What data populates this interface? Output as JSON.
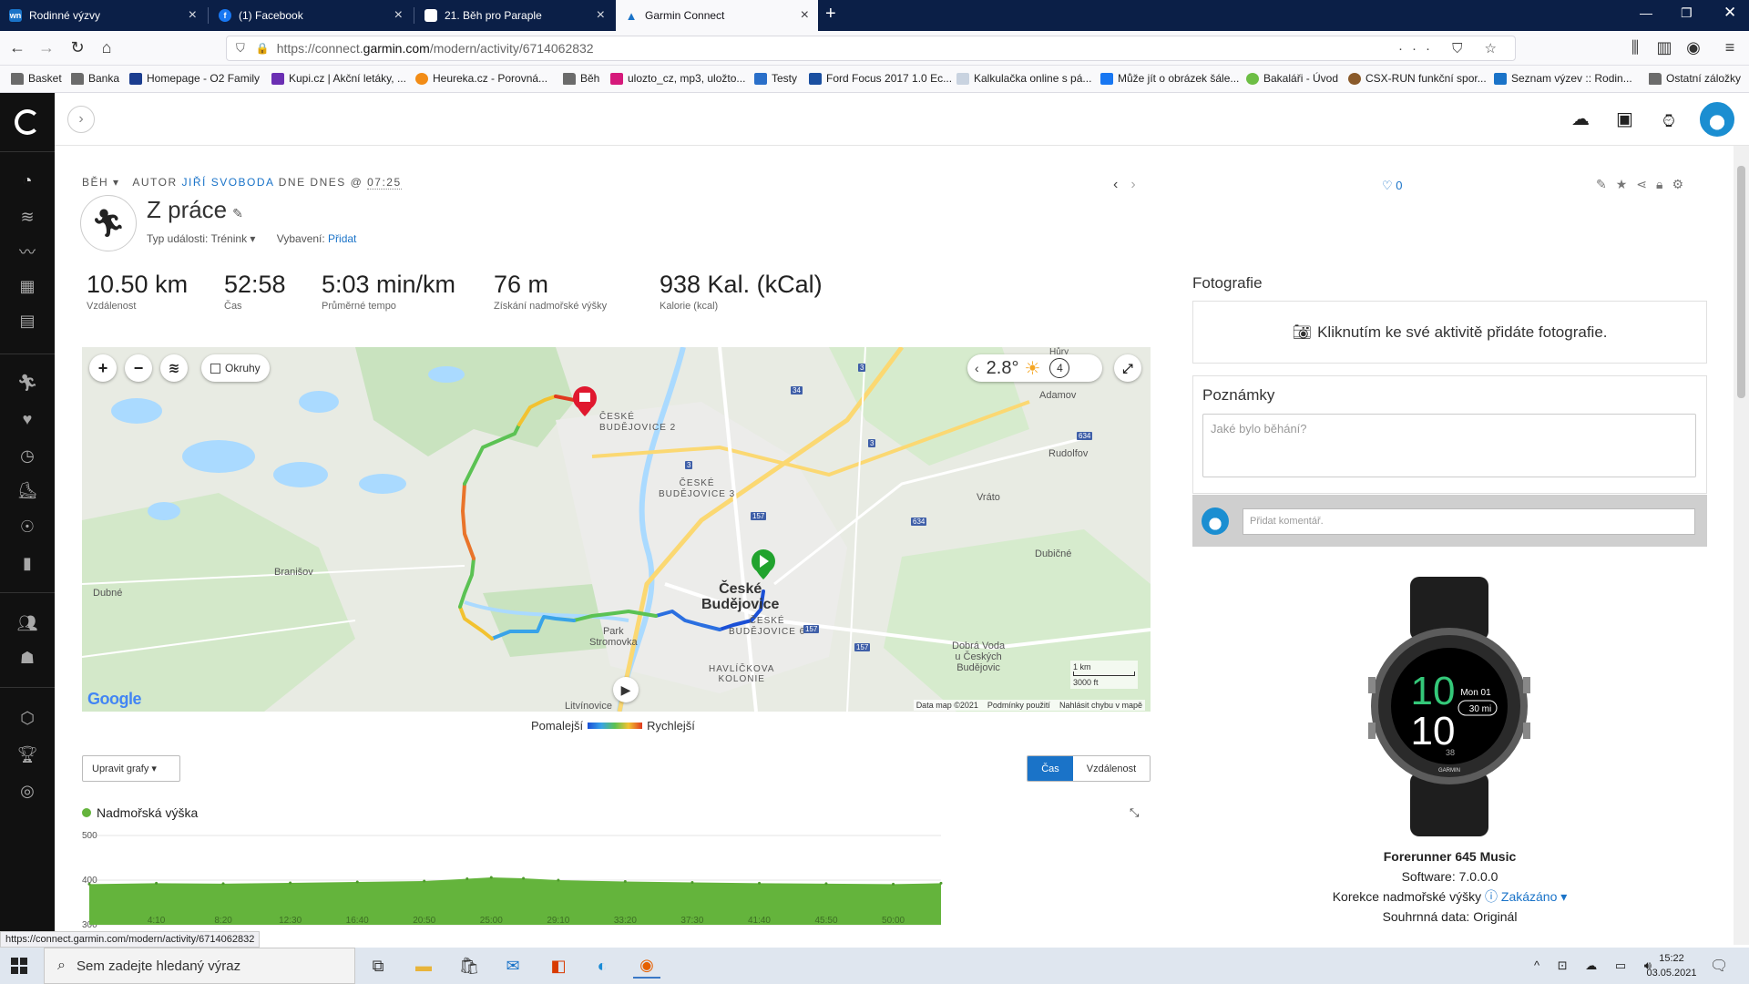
{
  "browser": {
    "tabs": [
      {
        "title": "Rodinné výzvy",
        "icon": "wn-icon",
        "color": "#1a73c8"
      },
      {
        "title": "(1) Facebook",
        "icon": "facebook-icon",
        "color": "#1877f2"
      },
      {
        "title": "21. Běh pro Paraple",
        "icon": "page-icon",
        "color": "#ffffff"
      },
      {
        "title": "Garmin Connect",
        "icon": "garmin-icon",
        "color": "#1a73c8",
        "active": true
      }
    ],
    "url_prefix": "https://connect.",
    "url_host": "garmin.com",
    "url_path": "/modern/activity/6714062832",
    "bookmarks": [
      {
        "label": "Basket",
        "icon": "folder-icon"
      },
      {
        "label": "Banka",
        "icon": "folder-icon"
      },
      {
        "label": "Homepage - O2 Family",
        "icon": "o2-icon"
      },
      {
        "label": "Kupi.cz | Akční letáky, ...",
        "icon": "kupi-icon"
      },
      {
        "label": "Heureka.cz - Porovná...",
        "icon": "heureka-icon"
      },
      {
        "label": "Běh",
        "icon": "folder-icon"
      },
      {
        "label": "ulozto_cz, mp3, uložto...",
        "icon": "download-icon"
      },
      {
        "label": "Testy",
        "icon": "testy-icon"
      },
      {
        "label": "Ford Focus 2017 1.0 Ec...",
        "icon": "ford-icon"
      },
      {
        "label": "Kalkulačka online s pá...",
        "icon": "calculator-icon"
      },
      {
        "label": "Může jít o obrázek šále...",
        "icon": "facebook-icon"
      },
      {
        "label": "Bakaláři - Úvod",
        "icon": "bakalari-icon"
      },
      {
        "label": "CSX-RUN funkční spor...",
        "icon": "csx-icon"
      },
      {
        "label": "Seznam výzev :: Rodin...",
        "icon": "wn-icon"
      }
    ],
    "other_bookmarks": "Ostatní záložky",
    "status_url": "https://connect.garmin.com/modern/activity/6714062832"
  },
  "activity": {
    "type": "BĚH",
    "author_prefix": "AUTOR",
    "author": "JIŘÍ SVOBODA",
    "date_prefix": "DNE DNES @",
    "time": "07:25",
    "title": "Z práce",
    "event_type_label": "Typ události:",
    "event_type": "Trénink",
    "gear_label": "Vybavení:",
    "gear_action": "Přidat",
    "likes": "0"
  },
  "stats": [
    {
      "value": "10.50 km",
      "label": "Vzdálenost"
    },
    {
      "value": "52:58",
      "label": "Čas"
    },
    {
      "value": "5:03 min/km",
      "label": "Průměrné tempo"
    },
    {
      "value": "76 m",
      "label": "Získání nadmořské výšky"
    },
    {
      "value": "938 Kal. (kCal)",
      "label": "Kalorie (kcal)"
    }
  ],
  "map": {
    "laps_label": "Okruhy",
    "temperature": "2.8°",
    "wind": "4",
    "scale_metric": "1 km",
    "scale_imperial": "3000 ft",
    "google": "Google",
    "attribution": [
      "Data map ©2021",
      "Podmínky použití",
      "Nahlásit chybu v mapě"
    ],
    "places": {
      "adamov": "Adamov",
      "rudolfov": "Rudolfov",
      "vrato": "Vráto",
      "dubicne": "Dubičné",
      "branisov": "Branišov",
      "dubne": "Dubné",
      "park": "Park\nStromovka",
      "litvinovice": "Litvínovice",
      "havlickova": "HAVLÍČKOVA\nKOLONIE",
      "dobra_voda": "Dobrá Voda\nu Českých\nBudějovic",
      "cb": "České\nBudějovice",
      "cb2": "ČESKÉ\nBUDĚJOVICE 2",
      "cb3": "ČESKÉ\nBUDĚJOVICE 3",
      "cb6": "ČESKÉ\nBUDĚJOVICE 6",
      "hury": "Hůry"
    },
    "road_numbers": [
      "34",
      "3",
      "3",
      "634",
      "634",
      "157",
      "157",
      "157",
      "3"
    ]
  },
  "legend": {
    "slow": "Pomalejší",
    "fast": "Rychlejší"
  },
  "graphs": {
    "edit_label": "Upravit grafy ▾",
    "toggle_time": "Čas",
    "toggle_distance": "Vzdálenost",
    "elevation_title": "Nadmořská výška",
    "elevation_color": "#64b43c"
  },
  "chart_data": {
    "type": "area",
    "title": "Nadmořská výška",
    "x_tick_labels": [
      "4:10",
      "8:20",
      "12:30",
      "16:40",
      "20:50",
      "25:00",
      "29:10",
      "33:20",
      "37:30",
      "41:40",
      "45:50",
      "50:00"
    ],
    "y_tick_labels": [
      "500",
      "400",
      "300"
    ],
    "ylim": [
      300,
      500
    ],
    "x_minutes": [
      0,
      4.17,
      8.33,
      12.5,
      16.67,
      20.83,
      23.5,
      25,
      27,
      29.17,
      33.33,
      37.5,
      41.67,
      45.83,
      50,
      52.97
    ],
    "y_meters": [
      391,
      393,
      392,
      394,
      396,
      398,
      403,
      406,
      404,
      400,
      397,
      395,
      393,
      392,
      391,
      393
    ]
  },
  "sidebar": {
    "icons": [
      "dashboard-icon",
      "layers-icon",
      "reports-icon",
      "calendar-icon",
      "news-icon",
      "activity-icon",
      "heart-icon",
      "stopwatch-icon",
      "shoe-icon",
      "insights-icon",
      "stats-icon",
      "connections-icon",
      "groups-icon",
      "badges-icon",
      "trophy-icon",
      "challenges-icon"
    ]
  },
  "right_panel": {
    "photos_title": "Fotografie",
    "photos_prompt": "Kliknutím ke své aktivitě přidáte fotografie.",
    "notes_title": "Poznámky",
    "notes_placeholder": "Jaké bylo běhání?",
    "comment_placeholder": "Přidat komentář.",
    "device_name": "Forerunner 645 Music",
    "software": "Software: 7.0.0.0",
    "elevation_correction_label": "Korekce nadmořské výšky",
    "elevation_correction_value": "Zakázáno",
    "summary_data": "Souhrnná data: Originál",
    "watch_face": {
      "hour": "10",
      "minute": "10",
      "date": "Mon 01",
      "run": "30 mi",
      "seconds": "38",
      "brand": "GARMIN"
    }
  },
  "taskbar": {
    "search_placeholder": "Sem zadejte hledaný výraz",
    "time": "15:22",
    "date": "03.05.2021"
  }
}
